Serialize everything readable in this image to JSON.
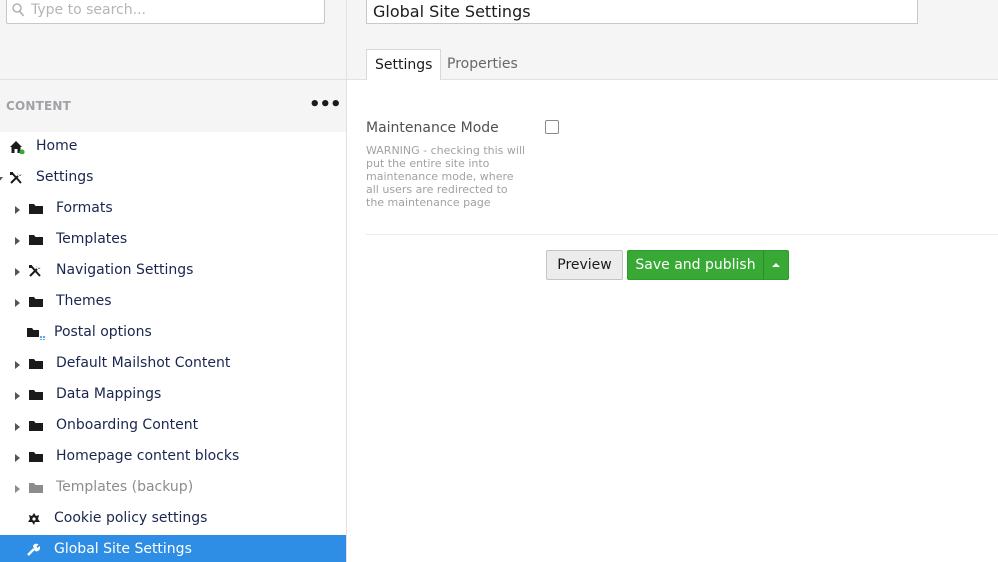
{
  "search": {
    "placeholder": "Type to search..."
  },
  "tree": {
    "section_title": "CONTENT",
    "actions_label": "•••",
    "nodes": [
      {
        "label": "Home",
        "icon": "home-icon"
      },
      {
        "label": "Settings",
        "icon": "tools-icon"
      },
      {
        "label": "Formats",
        "icon": "folder-icon"
      },
      {
        "label": "Templates",
        "icon": "folder-icon"
      },
      {
        "label": "Navigation Settings",
        "icon": "tools-icon"
      },
      {
        "label": "Themes",
        "icon": "folder-icon"
      },
      {
        "label": "Postal options",
        "icon": "folder-dotted-icon"
      },
      {
        "label": "Default Mailshot Content",
        "icon": "folder-icon"
      },
      {
        "label": "Data Mappings",
        "icon": "folder-icon"
      },
      {
        "label": "Onboarding Content",
        "icon": "folder-icon"
      },
      {
        "label": "Homepage content blocks",
        "icon": "folder-icon"
      },
      {
        "label": "Templates (backup)",
        "icon": "folder-icon"
      },
      {
        "label": "Cookie policy settings",
        "icon": "cookie-icon"
      },
      {
        "label": "Global Site Settings",
        "icon": "wrench-icon"
      }
    ]
  },
  "editor": {
    "name_value": "Global Site Settings",
    "tabs": [
      {
        "label": "Settings",
        "active": true
      },
      {
        "label": "Properties",
        "active": false
      }
    ],
    "property": {
      "label": "Maintenance Mode",
      "description": "WARNING - checking this will put the entire site into maintenance mode, where all users are redirected to the maintenance page",
      "checked": false
    },
    "buttons": {
      "preview": "Preview",
      "save_publish": "Save and publish"
    }
  },
  "colors": {
    "selected_row": "#2e8ee5",
    "publish_green": "#38a935",
    "panel_bg": "#f5f5f5"
  }
}
